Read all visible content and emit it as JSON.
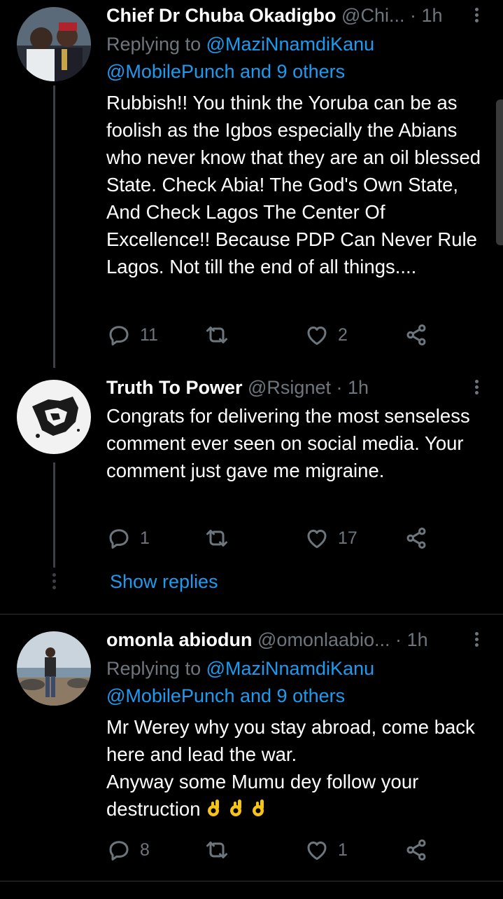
{
  "tweets": [
    {
      "name": "Chief Dr Chuba Okadigbo",
      "handle": "@Chi...",
      "dot": "·",
      "time": "1h",
      "reply_label": "Replying to",
      "reply_handle": "@MaziNnamdiKanu",
      "reply_extra": "@MobilePunch and 9 others",
      "text": "Rubbish!! You think the Yoruba can be as foolish as the Igbos especially the Abians who never know that they are an oil blessed State. Check Abia! The God's Own State, And Check Lagos The Center Of Excellence!! Because PDP Can Never Rule Lagos. Not till the end of all things....",
      "replies": "11",
      "retweets": "",
      "likes": "2"
    },
    {
      "name": "Truth To Power",
      "handle": "@Rsignet",
      "dot": "·",
      "time": "1h",
      "text": "Congrats for delivering the most senseless comment ever seen on social media. Your comment just gave me migraine.",
      "replies": "1",
      "retweets": "",
      "likes": "17",
      "show_replies": "Show replies"
    },
    {
      "name": "omonla abiodun",
      "handle": "@omonlaabio...",
      "dot": "·",
      "time": "1h",
      "reply_label": "Replying to",
      "reply_handle": "@MaziNnamdiKanu",
      "reply_extra": "@MobilePunch and 9 others",
      "text": "Mr Werey why you stay abroad, come back here and lead the war.\nAnyway some Mumu dey follow your destruction",
      "emoji": "ok-hand-emoji x3",
      "replies": "8",
      "retweets": "",
      "likes": "1"
    }
  ],
  "icons": {
    "reply": "reply-icon",
    "retweet": "retweet-icon",
    "like": "heart-icon",
    "share": "share-icon",
    "more": "more-vertical-icon"
  },
  "colors": {
    "background": "#000000",
    "link": "#1d9bf0",
    "secondary": "#6e767d",
    "divider": "#2f3336"
  }
}
